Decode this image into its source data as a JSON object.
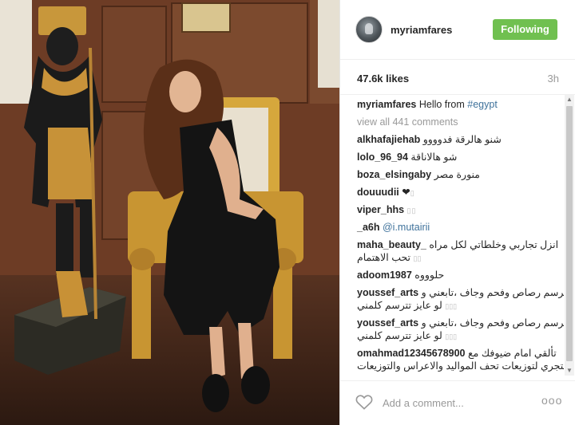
{
  "header": {
    "username": "myriamfares",
    "follow_label": "Following"
  },
  "stats": {
    "likes": "47.6k likes",
    "time": "3h"
  },
  "caption": {
    "username": "myriamfares",
    "text": "Hello from ",
    "hashtag": "#egypt"
  },
  "view_all": "view all 441 comments",
  "comments": [
    {
      "user": "alkhafajiehab",
      "text": "شنو هالرقة فدوووو"
    },
    {
      "user": "lolo_96_94",
      "text": "شو هالاناقة"
    },
    {
      "user": "boza_elsingaby",
      "text": "منورة مصر"
    },
    {
      "user": "douuudii",
      "text": "❤",
      "extra": "▯"
    },
    {
      "user": "viper_hhs",
      "text": "",
      "extra": "▯▯"
    },
    {
      "user": "_a6h",
      "text": "",
      "mention": "@i.mutairii"
    },
    {
      "user": "maha_beauty_",
      "text": "انزل تجاربي وخلطاتي لكل مراه",
      "line2": "تحب الاهتمام",
      "extra": "▯▯"
    },
    {
      "user": "adoom1987",
      "text": "حلوووه"
    },
    {
      "user": "youssef_arts",
      "text": "برسم رصاص وفحم وجاف ،تابعني و",
      "line2": "لو عايز تترسم كلمني",
      "extra": "▯▯▯"
    },
    {
      "user": "youssef_arts",
      "text": "برسم رصاص وفحم وجاف ،تابعني و",
      "line2": "لو عايز تترسم كلمني",
      "extra": "▯▯▯"
    },
    {
      "user": "omahmad12345678900",
      "text": "تألقي امام ضيوفك مع",
      "line2": "متجري لتوزيعات تحف المواليد والاعراس والتوزيعات"
    }
  ],
  "footer": {
    "placeholder": "Add a comment...",
    "more": "ooo"
  },
  "colors": {
    "follow_green": "#70c050",
    "link_blue": "#3f729b",
    "muted_gray": "#999999"
  },
  "icons": [
    "heart-icon",
    "more-options-icon",
    "scroll-up-arrow-icon",
    "scroll-down-arrow-icon"
  ]
}
